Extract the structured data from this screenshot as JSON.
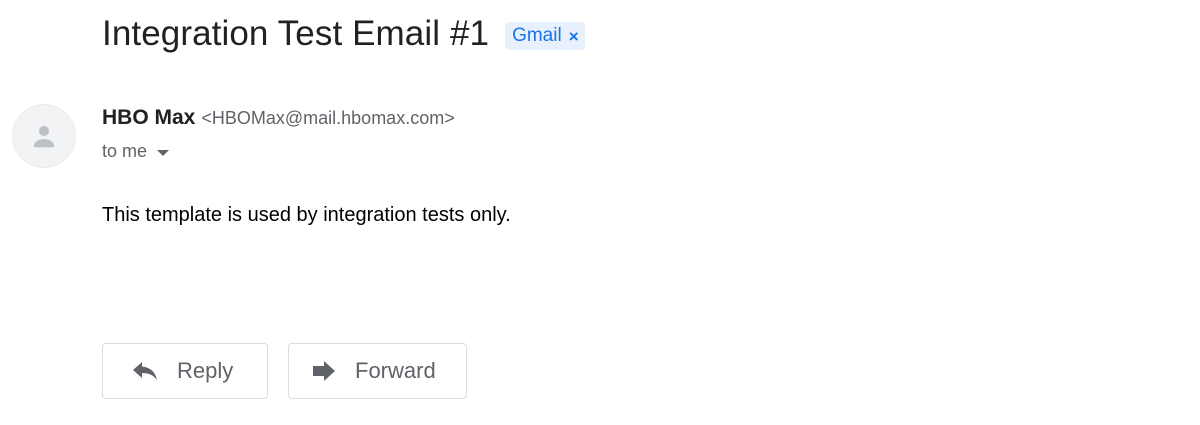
{
  "email": {
    "subject": "Integration Test Email #1",
    "label": {
      "text": "Gmail",
      "remove_symbol": "×",
      "bg_color": "#e8f0fe",
      "text_color": "#1a73e8"
    },
    "sender": {
      "name": "HBO Max",
      "email": "<HBOMax@mail.hbomax.com>",
      "avatar_icon": "person-icon"
    },
    "recipient": {
      "text": "to me",
      "dropdown_icon": "caret-down-icon"
    },
    "body": "This template is used by integration tests only."
  },
  "actions": {
    "reply_label": "Reply",
    "reply_icon": "reply-arrow-icon",
    "forward_label": "Forward",
    "forward_icon": "forward-arrow-icon"
  }
}
